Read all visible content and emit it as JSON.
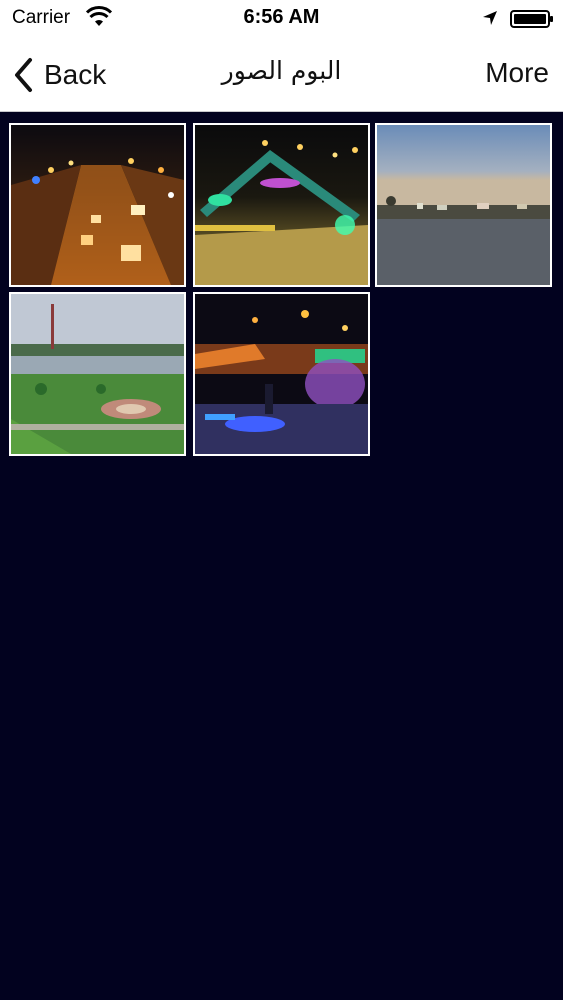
{
  "status_bar": {
    "carrier": "Carrier",
    "time": "6:56 AM",
    "icons": [
      "wifi-icon",
      "location-icon",
      "battery-icon"
    ]
  },
  "nav_bar": {
    "back_label": "Back",
    "title": "البوم الصور",
    "more_label": "More",
    "back_icon": "chevron-left-icon"
  },
  "gallery": {
    "photos": [
      {
        "name": "city-street-night"
      },
      {
        "name": "lit-monument-night"
      },
      {
        "name": "river-dusk"
      },
      {
        "name": "riverside-garden"
      },
      {
        "name": "park-lights-night"
      }
    ]
  },
  "colors": {
    "background": "#02021f",
    "bar": "#ffffff",
    "text": "#111111"
  }
}
